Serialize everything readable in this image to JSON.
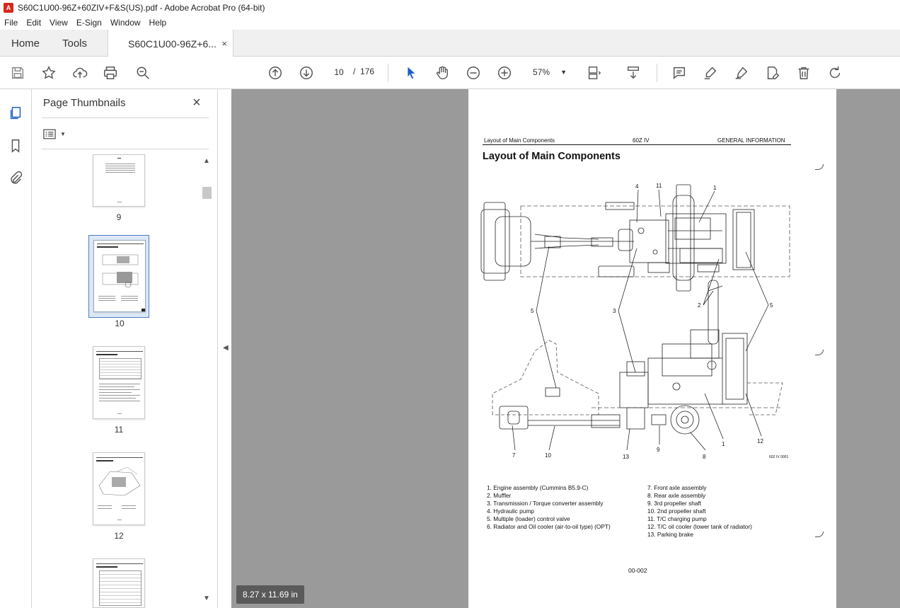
{
  "window": {
    "title": "S60C1U00-96Z+60ZIV+F&S(US).pdf - Adobe Acrobat Pro (64-bit)"
  },
  "menu": [
    "File",
    "Edit",
    "View",
    "E-Sign",
    "Window",
    "Help"
  ],
  "tabs": {
    "home": "Home",
    "tools": "Tools",
    "document": "S60C1U00-96Z+6...",
    "close": "×"
  },
  "toolbar": {
    "current_page": "10",
    "page_separator": "/",
    "total_pages": "176",
    "zoom": "57%"
  },
  "thumbnails": {
    "title": "Page Thumbnails",
    "close": "×",
    "pages": [
      {
        "label": "9"
      },
      {
        "label": "10",
        "selected": true
      },
      {
        "label": "11"
      },
      {
        "label": "12"
      }
    ]
  },
  "document": {
    "page_size": "8.27 x 11.69 in",
    "header_left": "Layout of Main Components",
    "header_center": "60Z IV",
    "header_right": "GENERAL INFORMATION",
    "title": "Layout of Main Components",
    "figure_code": "60Z IV 0001",
    "callouts": [
      "4",
      "11",
      "1",
      "5",
      "3",
      "2",
      "5",
      "7",
      "10",
      "13",
      "9",
      "8",
      "1",
      "12"
    ],
    "legend_left": [
      "1.  Engine assembly (Cummins B5.9-C)",
      "2.  Muffler",
      "3.  Transmission / Torque converter assembly",
      "4.  Hydraulic pump",
      "5.  Multiple (loader) control valve",
      "6.  Radiator and Oil cooler (air-to-oil type) (OPT)"
    ],
    "legend_right": [
      "7.  Front axle assembly",
      "8.  Rear axle assembly",
      "9.  3rd propeller shaft",
      "10.  2nd propeller shaft",
      "11.  T/C charging pump",
      "12.  T/C oil cooler (lower tank of radiator)",
      "13.  Parking brake"
    ],
    "footer": "00-002"
  }
}
